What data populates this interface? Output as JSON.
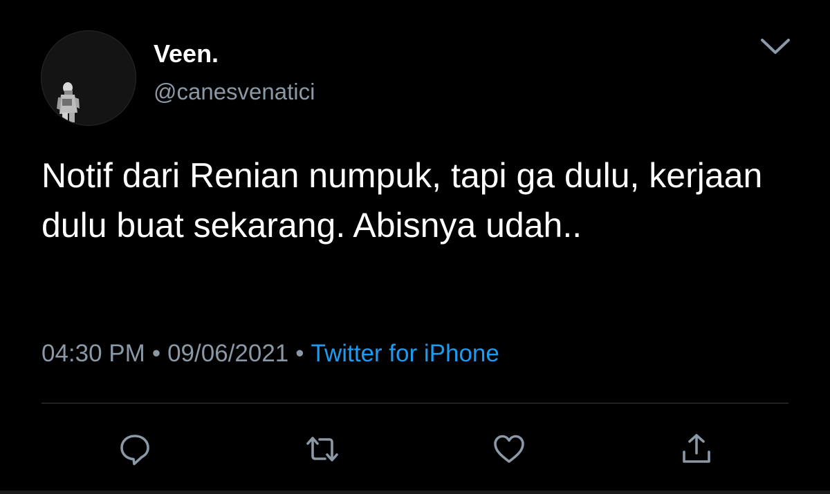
{
  "tweet": {
    "display_name": "Veen.",
    "handle": "@canesvenatici",
    "text": "Notif dari Renian numpuk, tapi ga dulu, kerjaan dulu buat sekarang. Abisnya udah..",
    "time": "04:30 PM",
    "separator": "•",
    "date": "09/06/2021",
    "source": "Twitter for iPhone"
  },
  "icons": {
    "avatar": "astronaut-avatar",
    "menu": "chevron-down-icon",
    "reply": "reply-icon",
    "retweet": "retweet-icon",
    "like": "heart-icon",
    "share": "share-icon"
  },
  "colors": {
    "background": "#000000",
    "text_primary": "#ffffff",
    "text_secondary": "#8b98a5",
    "link": "#1d9bf0",
    "icon": "#8b98a5",
    "divider": "#3a3f44"
  }
}
